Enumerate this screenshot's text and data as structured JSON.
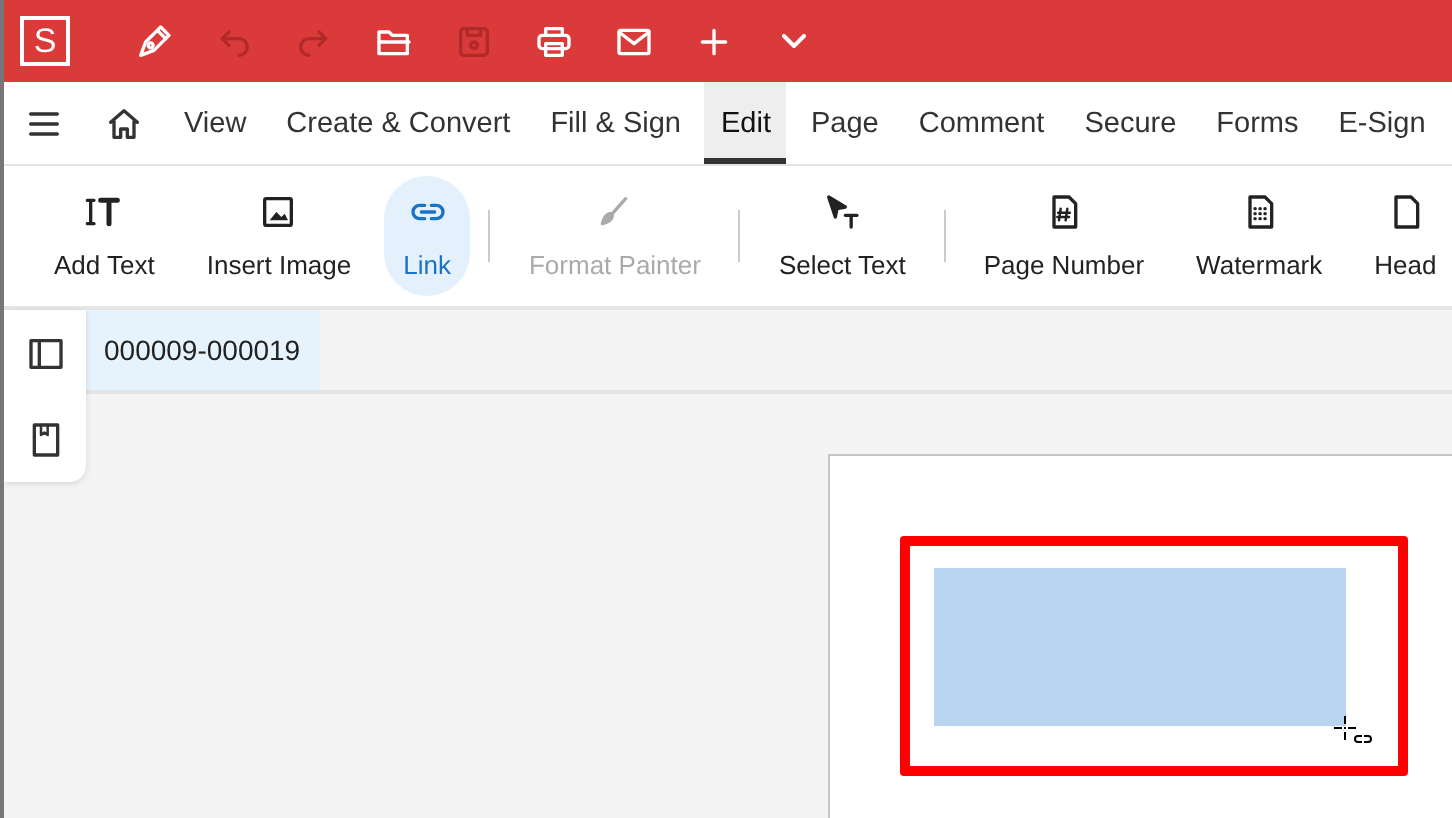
{
  "title_bar": {
    "logo": "S",
    "buttons": [
      {
        "disabled": false
      },
      {
        "disabled": true
      },
      {
        "disabled": true
      },
      {
        "disabled": false
      },
      {
        "disabled": true
      },
      {
        "disabled": false
      },
      {
        "disabled": false
      },
      {
        "disabled": false
      },
      {
        "disabled": false
      }
    ]
  },
  "menu_tabs": [
    {
      "label": "View",
      "selected": false
    },
    {
      "label": "Create & Convert",
      "selected": false
    },
    {
      "label": "Fill & Sign",
      "selected": false
    },
    {
      "label": "Edit",
      "selected": true
    },
    {
      "label": "Page",
      "selected": false
    },
    {
      "label": "Comment",
      "selected": false
    },
    {
      "label": "Secure",
      "selected": false
    },
    {
      "label": "Forms",
      "selected": false
    },
    {
      "label": "E-Sign",
      "selected": false
    }
  ],
  "toolbar": [
    {
      "label": "Add Text",
      "selected": false,
      "disabled": false,
      "separator_before": false
    },
    {
      "label": "Insert Image",
      "selected": false,
      "disabled": false,
      "separator_before": false
    },
    {
      "label": "Link",
      "selected": true,
      "disabled": false,
      "separator_before": false
    },
    {
      "label": "Format Painter",
      "selected": false,
      "disabled": true,
      "separator_before": true
    },
    {
      "label": "Select Text",
      "selected": false,
      "disabled": false,
      "separator_before": true
    },
    {
      "label": "Page Number",
      "selected": false,
      "disabled": false,
      "separator_before": true
    },
    {
      "label": "Watermark",
      "selected": false,
      "disabled": false,
      "separator_before": false
    },
    {
      "label": "Head",
      "selected": false,
      "disabled": false,
      "separator_before": false
    }
  ],
  "document_tabs": [
    {
      "label": "000009-000019",
      "selected": true
    }
  ]
}
